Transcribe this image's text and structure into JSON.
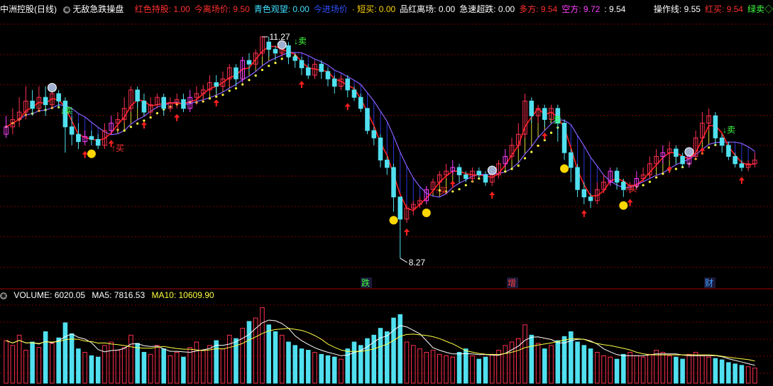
{
  "header": {
    "stock": "中洲控股(日线)",
    "indicator": "无敌急跌操盘",
    "items": [
      {
        "label": "红色持股: 1.00",
        "color": "#ff3030"
      },
      {
        "label": "今离场价: 9.50",
        "color": "#ff3030"
      },
      {
        "label": "青色观望: 0.00",
        "color": "#40e0ff"
      },
      {
        "label": "今进场价",
        "color": "#3050ff"
      },
      {
        "label": "· 短买: 0.00",
        "color": "#ffd700"
      },
      {
        "label": "品红离场: 0.00",
        "color": "#ffffff"
      },
      {
        "label": "急速超跌: 0.00",
        "color": "#ffffff"
      },
      {
        "label": "多方: 9.54",
        "color": "#ff3030"
      },
      {
        "label": "空方: 9.72",
        "color": "#ff40ff"
      },
      {
        "label": ": 9.54",
        "color": "#ffffff"
      }
    ],
    "right": [
      {
        "label": "操作线: 9.55",
        "color": "#ffffff"
      },
      {
        "label": "红买: 9.54",
        "color": "#ff3030"
      },
      {
        "label": "绿卖◇",
        "color": "#40ff40"
      }
    ]
  },
  "volume_header": {
    "volume": "VOLUME: 6020.05",
    "ma5": "MA5: 7816.53",
    "ma10": "MA10: 10609.90"
  },
  "annotations": {
    "high": "11.27",
    "low": "8.27",
    "sell": "↓卖",
    "buy": "↑买",
    "tags": [
      {
        "text": "跌",
        "color": "#40ff40"
      },
      {
        "text": "增",
        "color": "#ff4040"
      },
      {
        "text": "财",
        "color": "#40a0ff"
      }
    ]
  },
  "colors": {
    "up": "#ff3050",
    "down": "#50e0f0",
    "magenta": "#ff40ff",
    "yellow": "#ffff40",
    "red_line": "#ff2020",
    "blue_fill": "#3040ff",
    "grid": "#7a0000",
    "vol_ma5": "#ffffff",
    "vol_ma10": "#ffff40"
  },
  "chart_data": {
    "type": "candlestick",
    "price_range": [
      8.0,
      11.5
    ],
    "candles": [
      [
        9.95,
        10.05,
        9.9,
        10.2
      ],
      [
        10.05,
        10.15,
        9.95,
        10.3
      ],
      [
        10.15,
        10.25,
        10.05,
        10.45
      ],
      [
        10.25,
        10.4,
        10.15,
        10.6
      ],
      [
        10.4,
        10.3,
        10.2,
        10.55
      ],
      [
        10.3,
        10.45,
        10.25,
        10.6
      ],
      [
        10.45,
        10.35,
        10.2,
        10.6
      ],
      [
        10.35,
        10.5,
        10.3,
        10.62
      ],
      [
        10.5,
        10.4,
        10.3,
        10.55
      ],
      [
        10.4,
        10.05,
        9.7,
        10.45
      ],
      [
        10.05,
        9.95,
        9.8,
        10.2
      ],
      [
        9.95,
        9.85,
        9.75,
        10.1
      ],
      [
        9.85,
        9.92,
        9.8,
        10.0
      ],
      [
        9.92,
        9.88,
        9.8,
        10.0
      ],
      [
        9.88,
        9.8,
        9.75,
        9.95
      ],
      [
        9.8,
        10.0,
        9.75,
        10.1
      ],
      [
        10.0,
        10.1,
        9.95,
        10.2
      ],
      [
        10.1,
        10.15,
        10.0,
        10.25
      ],
      [
        10.15,
        10.3,
        10.1,
        10.45
      ],
      [
        10.3,
        10.55,
        10.25,
        10.6
      ],
      [
        10.55,
        10.4,
        10.3,
        10.6
      ],
      [
        10.4,
        10.25,
        10.2,
        10.5
      ],
      [
        10.25,
        10.35,
        10.2,
        10.45
      ],
      [
        10.35,
        10.45,
        10.3,
        10.5
      ],
      [
        10.45,
        10.3,
        10.2,
        10.5
      ],
      [
        10.3,
        10.38,
        10.25,
        10.45
      ],
      [
        10.38,
        10.42,
        10.3,
        10.5
      ],
      [
        10.42,
        10.3,
        10.25,
        10.5
      ],
      [
        10.3,
        10.45,
        10.25,
        10.55
      ],
      [
        10.45,
        10.5,
        10.35,
        10.6
      ],
      [
        10.5,
        10.55,
        10.4,
        10.62
      ],
      [
        10.55,
        10.65,
        10.5,
        10.75
      ],
      [
        10.65,
        10.6,
        10.5,
        10.75
      ],
      [
        10.6,
        10.7,
        10.55,
        10.8
      ],
      [
        10.7,
        10.85,
        10.6,
        10.9
      ],
      [
        10.85,
        10.7,
        10.6,
        10.9
      ],
      [
        10.7,
        10.95,
        10.65,
        11.0
      ],
      [
        10.95,
        10.9,
        10.8,
        11.05
      ],
      [
        10.9,
        11.05,
        10.85,
        11.1
      ],
      [
        11.05,
        11.27,
        11.0,
        11.27
      ],
      [
        11.2,
        11.1,
        11.0,
        11.27
      ],
      [
        11.1,
        11.05,
        10.95,
        11.15
      ],
      [
        11.05,
        11.15,
        11.0,
        11.2
      ],
      [
        11.15,
        11.0,
        10.9,
        11.2
      ],
      [
        11.0,
        10.95,
        10.85,
        11.05
      ],
      [
        10.95,
        10.85,
        10.75,
        11.0
      ],
      [
        10.85,
        10.75,
        10.7,
        10.9
      ],
      [
        10.75,
        10.9,
        10.7,
        10.95
      ],
      [
        10.9,
        10.8,
        10.7,
        10.95
      ],
      [
        10.8,
        10.7,
        10.6,
        10.85
      ],
      [
        10.7,
        10.6,
        10.5,
        10.75
      ],
      [
        10.6,
        10.7,
        10.55,
        10.75
      ],
      [
        10.7,
        10.55,
        10.45,
        10.75
      ],
      [
        10.55,
        10.45,
        10.4,
        10.6
      ],
      [
        10.45,
        10.3,
        10.25,
        10.5
      ],
      [
        10.3,
        10.0,
        9.95,
        10.3
      ],
      [
        10.0,
        9.9,
        9.8,
        10.05
      ],
      [
        9.9,
        9.6,
        9.5,
        9.95
      ],
      [
        9.6,
        9.5,
        9.4,
        9.65
      ],
      [
        9.5,
        9.1,
        8.9,
        9.55
      ],
      [
        9.1,
        8.8,
        8.27,
        9.1
      ],
      [
        8.8,
        8.95,
        8.75,
        9.0
      ],
      [
        8.95,
        9.0,
        8.85,
        9.05
      ],
      [
        9.0,
        9.05,
        8.95,
        9.1
      ],
      [
        9.05,
        9.2,
        9.0,
        9.25
      ],
      [
        9.2,
        9.3,
        9.15,
        9.35
      ],
      [
        9.3,
        9.4,
        9.25,
        9.45
      ],
      [
        9.4,
        9.45,
        9.35,
        9.55
      ],
      [
        9.45,
        9.5,
        9.4,
        9.6
      ],
      [
        9.5,
        9.4,
        9.3,
        9.55
      ],
      [
        9.4,
        9.35,
        9.3,
        9.45
      ],
      [
        9.35,
        9.45,
        9.3,
        9.5
      ],
      [
        9.45,
        9.4,
        9.35,
        9.5
      ],
      [
        9.4,
        9.3,
        9.25,
        9.45
      ],
      [
        9.3,
        9.4,
        9.25,
        9.5
      ],
      [
        9.4,
        9.55,
        9.35,
        9.6
      ],
      [
        9.55,
        9.65,
        9.5,
        9.75
      ],
      [
        9.65,
        9.8,
        9.6,
        9.9
      ],
      [
        9.8,
        9.95,
        9.75,
        10.1
      ],
      [
        9.95,
        10.4,
        9.9,
        10.5
      ],
      [
        10.4,
        10.2,
        10.1,
        10.45
      ],
      [
        10.2,
        10.3,
        10.1,
        10.35
      ],
      [
        10.3,
        10.15,
        10.05,
        10.35
      ],
      [
        10.15,
        10.3,
        10.1,
        10.35
      ],
      [
        10.3,
        10.1,
        9.85,
        10.35
      ],
      [
        10.1,
        9.7,
        9.6,
        10.15
      ],
      [
        9.7,
        9.5,
        9.3,
        9.75
      ],
      [
        9.5,
        9.2,
        9.1,
        9.55
      ],
      [
        9.2,
        9.1,
        9.0,
        9.3
      ],
      [
        9.1,
        9.05,
        8.95,
        9.15
      ],
      [
        9.05,
        9.2,
        9.0,
        9.3
      ],
      [
        9.2,
        9.3,
        9.15,
        9.4
      ],
      [
        9.3,
        9.45,
        9.25,
        9.5
      ],
      [
        9.45,
        9.3,
        9.2,
        9.5
      ],
      [
        9.3,
        9.2,
        9.1,
        9.35
      ],
      [
        9.2,
        9.25,
        9.15,
        9.3
      ],
      [
        9.25,
        9.35,
        9.2,
        9.45
      ],
      [
        9.35,
        9.4,
        9.3,
        9.5
      ],
      [
        9.4,
        9.55,
        9.35,
        9.65
      ],
      [
        9.55,
        9.65,
        9.5,
        9.75
      ],
      [
        9.65,
        9.7,
        9.55,
        9.8
      ],
      [
        9.7,
        9.75,
        9.6,
        9.85
      ],
      [
        9.75,
        9.65,
        9.55,
        9.8
      ],
      [
        9.65,
        9.55,
        9.5,
        9.7
      ],
      [
        9.55,
        9.65,
        9.5,
        9.75
      ],
      [
        9.65,
        9.9,
        9.6,
        10.0
      ],
      [
        9.9,
        10.1,
        9.85,
        10.25
      ],
      [
        10.1,
        10.2,
        10.0,
        10.3
      ],
      [
        10.2,
        9.9,
        9.8,
        10.25
      ],
      [
        9.9,
        9.8,
        9.7,
        9.95
      ],
      [
        9.8,
        9.65,
        9.6,
        9.85
      ],
      [
        9.65,
        9.55,
        9.5,
        9.7
      ],
      [
        9.55,
        9.5,
        9.45,
        9.6
      ],
      [
        9.5,
        9.55,
        9.45,
        9.6
      ],
      [
        9.55,
        9.6,
        9.5,
        9.7
      ]
    ],
    "volume": [
      62,
      55,
      70,
      48,
      60,
      52,
      75,
      58,
      66,
      88,
      72,
      50,
      45,
      40,
      38,
      55,
      60,
      48,
      52,
      70,
      58,
      45,
      42,
      55,
      50,
      40,
      45,
      38,
      52,
      60,
      48,
      55,
      62,
      50,
      70,
      65,
      80,
      90,
      95,
      110,
      85,
      75,
      70,
      60,
      55,
      50,
      48,
      45,
      42,
      40,
      38,
      35,
      50,
      60,
      55,
      65,
      70,
      80,
      75,
      95,
      100,
      60,
      55,
      50,
      45,
      48,
      42,
      40,
      38,
      45,
      50,
      40,
      35,
      38,
      42,
      48,
      55,
      60,
      65,
      85,
      70,
      58,
      50,
      55,
      62,
      68,
      75,
      60,
      55,
      50,
      45,
      40,
      38,
      35,
      42,
      45,
      40,
      38,
      42,
      48,
      45,
      40,
      38,
      35,
      42,
      45,
      40,
      38,
      36,
      34,
      30,
      28,
      26,
      24,
      22
    ],
    "volume_range": [
      0,
      120
    ],
    "ma5": 7816.53,
    "ma10": 10609.9,
    "volume_value": 6020.05
  }
}
